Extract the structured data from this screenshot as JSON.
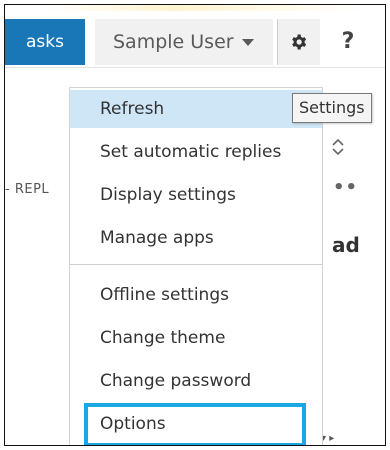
{
  "header": {
    "tasks_tab": "asks",
    "user_name": "Sample User",
    "help_label": "?"
  },
  "tooltip": {
    "text": "Settings"
  },
  "menu": {
    "group1": [
      {
        "label": "Refresh",
        "highlighted": true
      },
      {
        "label": "Set automatic replies"
      },
      {
        "label": "Display settings"
      },
      {
        "label": "Manage apps"
      }
    ],
    "group2": [
      {
        "label": "Offline settings"
      },
      {
        "label": "Change theme"
      },
      {
        "label": "Change password"
      },
      {
        "label": "Options",
        "outlined": true
      }
    ]
  },
  "background": {
    "repl_text": "- REPL",
    "arrows": "⌃\n⌄",
    "dots": "••",
    "ad_text": "ad",
    "tri": "▾ ▸"
  },
  "icons": {
    "settings": "gear-icon",
    "user_menu": "caret-down-icon"
  },
  "colors": {
    "accent_tab": "#1977b8",
    "menu_highlight": "#cfe6f6",
    "outline_highlight": "#1aa7e6"
  }
}
